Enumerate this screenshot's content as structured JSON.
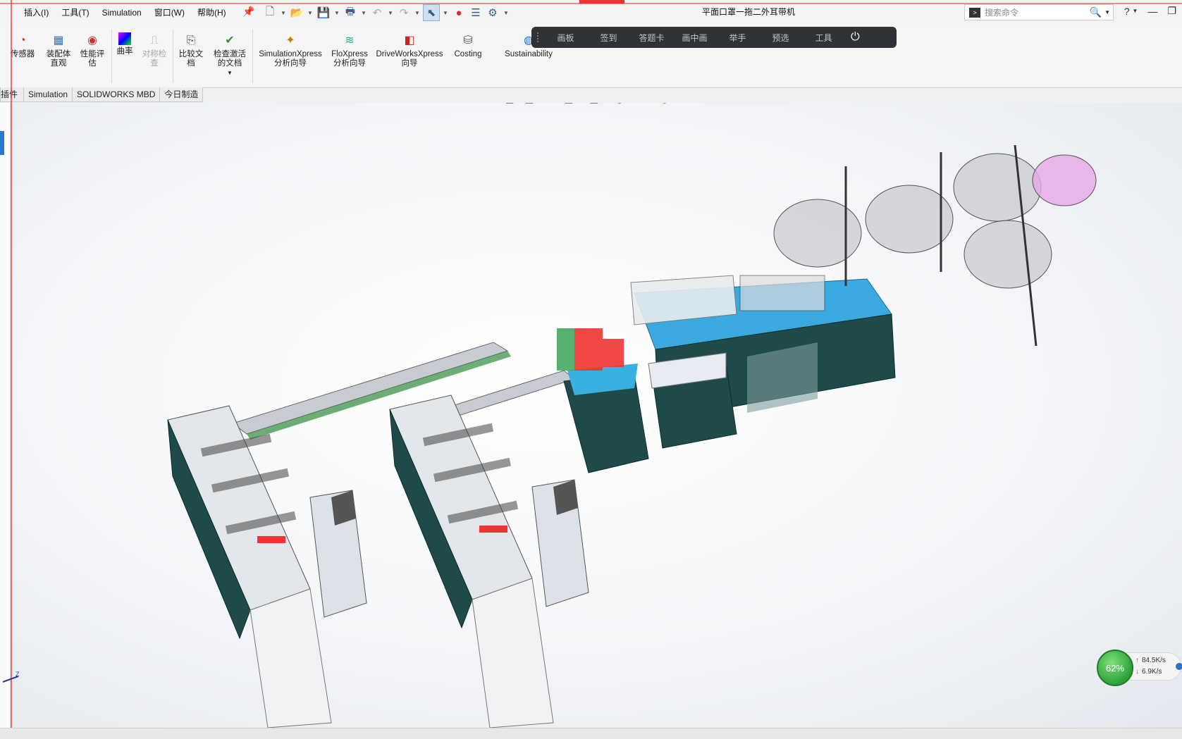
{
  "menu": {
    "items": [
      "插入(I)",
      "工具(T)",
      "Simulation",
      "窗口(W)",
      "帮助(H)"
    ]
  },
  "document": {
    "title": "平面口罩一拖二外耳带机"
  },
  "search": {
    "placeholder": "搜索命令"
  },
  "ribbon": {
    "buttons": [
      {
        "label": "传感器",
        "icon": "sensor-icon"
      },
      {
        "label": "装配体直观",
        "icon": "assembly-visualization-icon"
      },
      {
        "label": "性能评估",
        "icon": "performance-evaluation-icon"
      },
      {
        "label": "曲率",
        "icon": "curvature-icon"
      },
      {
        "label": "对称检查",
        "icon": "symmetry-check-icon",
        "disabled": true
      },
      {
        "label": "比较文档",
        "icon": "compare-documents-icon"
      },
      {
        "label": "检查激活的文档",
        "icon": "check-active-document-icon"
      },
      {
        "label": "SimulationXpress 分析向导",
        "icon": "simulationxpress-icon"
      },
      {
        "label": "FloXpress 分析向导",
        "icon": "floxpress-icon"
      },
      {
        "label": "DriveWorksXpress 向导",
        "icon": "driveworksxpress-icon"
      },
      {
        "label": "Costing",
        "icon": "costing-icon"
      },
      {
        "label": "Sustainability",
        "icon": "sustainability-icon"
      }
    ]
  },
  "floatbar": {
    "items": [
      "画板",
      "签到",
      "答题卡",
      "画中画",
      "举手",
      "预选",
      "工具"
    ]
  },
  "tabs": [
    "插件",
    "Simulation",
    "SOLIDWORKS MBD",
    "今日制造"
  ],
  "net": {
    "percent": "62%",
    "upload": "84.5K/s",
    "download": "6.9K/s"
  },
  "axis": {
    "label": "Z"
  },
  "colors": {
    "accent_blue": "#2b78d0",
    "machine_table": "#39a9e0",
    "cabinet": "#1f4a4a",
    "red": "#e33"
  }
}
